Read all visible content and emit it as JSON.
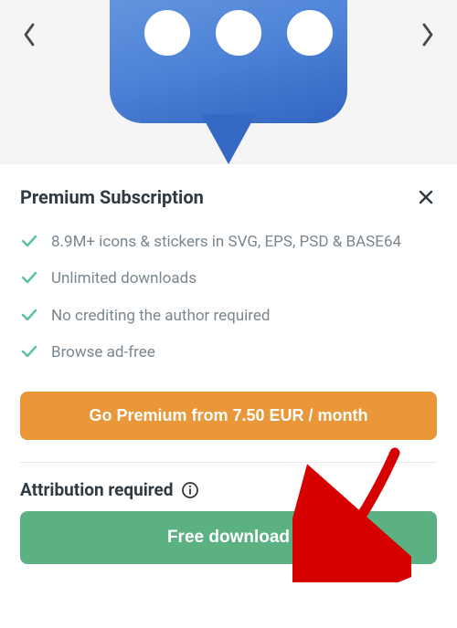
{
  "preview": {
    "icon_name": "chat-bubble-dots-icon"
  },
  "sheet": {
    "title": "Premium Subscription",
    "benefits": [
      "8.9M+ icons & stickers in SVG, EPS, PSD & BASE64",
      "Unlimited downloads",
      "No crediting the author required",
      "Browse ad-free"
    ],
    "premium_button": "Go Premium from 7.50 EUR / month",
    "attribution_title": "Attribution required",
    "free_button": "Free download"
  },
  "colors": {
    "premium_button_bg": "#e99739",
    "free_button_bg": "#5bb182",
    "check_color": "#5ec29a",
    "preview_icon_gradient": [
      "#6a9ae0",
      "#3265c0"
    ]
  }
}
